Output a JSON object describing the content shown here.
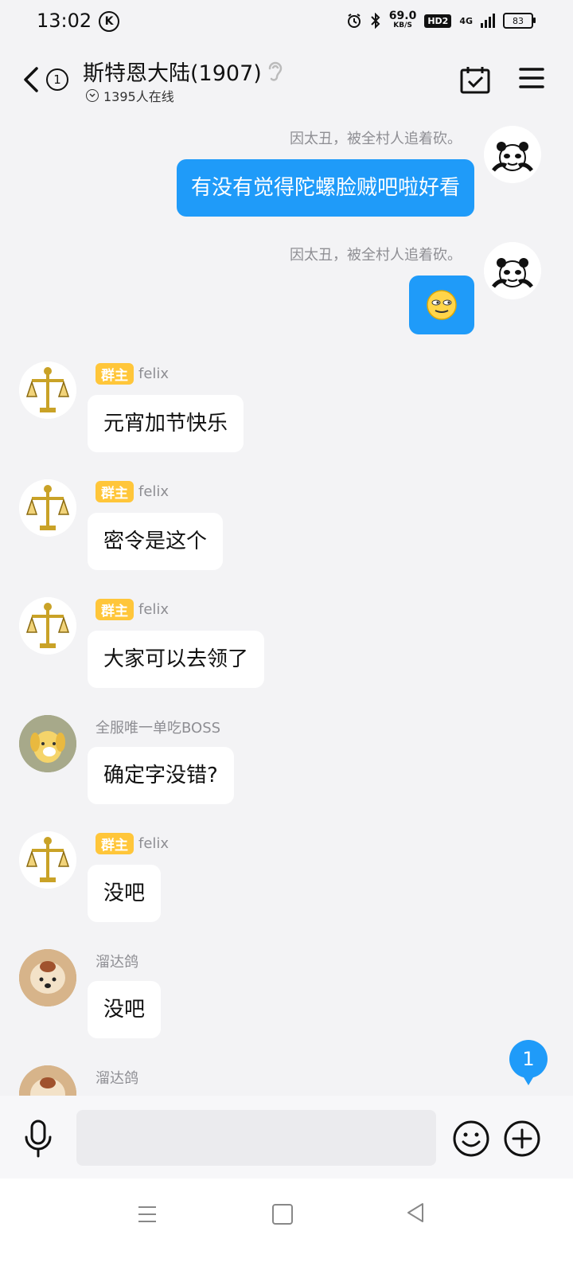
{
  "status_bar": {
    "time": "13:02",
    "app_badge": "K",
    "net_speed_value": "69.0",
    "net_speed_unit": "KB/S",
    "hd_label": "HD2",
    "network_label": "4G",
    "battery": "83"
  },
  "header": {
    "unread_count": "1",
    "title": "斯特恩大陆(1907)",
    "online_text": "1395人在线"
  },
  "messages": [
    {
      "side": "self",
      "sender": "因太丑，被全村人追着砍。",
      "text": "有没有觉得陀螺脸贼吧啦好看"
    },
    {
      "side": "self",
      "sender": "因太丑，被全村人追着砍。",
      "emoji": "sly-face"
    },
    {
      "side": "left",
      "badge": "群主",
      "sender": "felix",
      "text": "元宵加节快乐"
    },
    {
      "side": "left",
      "badge": "群主",
      "sender": "felix",
      "text": "密令是这个"
    },
    {
      "side": "left",
      "badge": "群主",
      "sender": "felix",
      "text": "大家可以去领了"
    },
    {
      "side": "left",
      "badge": "",
      "sender": "全服唯一单吃BOSS",
      "text": "确定字没错?"
    },
    {
      "side": "left",
      "badge": "群主",
      "sender": "felix",
      "text": "没吧"
    },
    {
      "side": "left",
      "badge": "",
      "sender": "溜达鸽",
      "text": "没吧"
    },
    {
      "side": "left",
      "badge": "",
      "sender": "溜达鸽",
      "text": ""
    }
  ],
  "new_message_count": "1",
  "input": {
    "placeholder": ""
  },
  "colors": {
    "accent": "#1f9bf9",
    "owner_badge": "#ffc63a",
    "background": "#f3f3f5"
  }
}
